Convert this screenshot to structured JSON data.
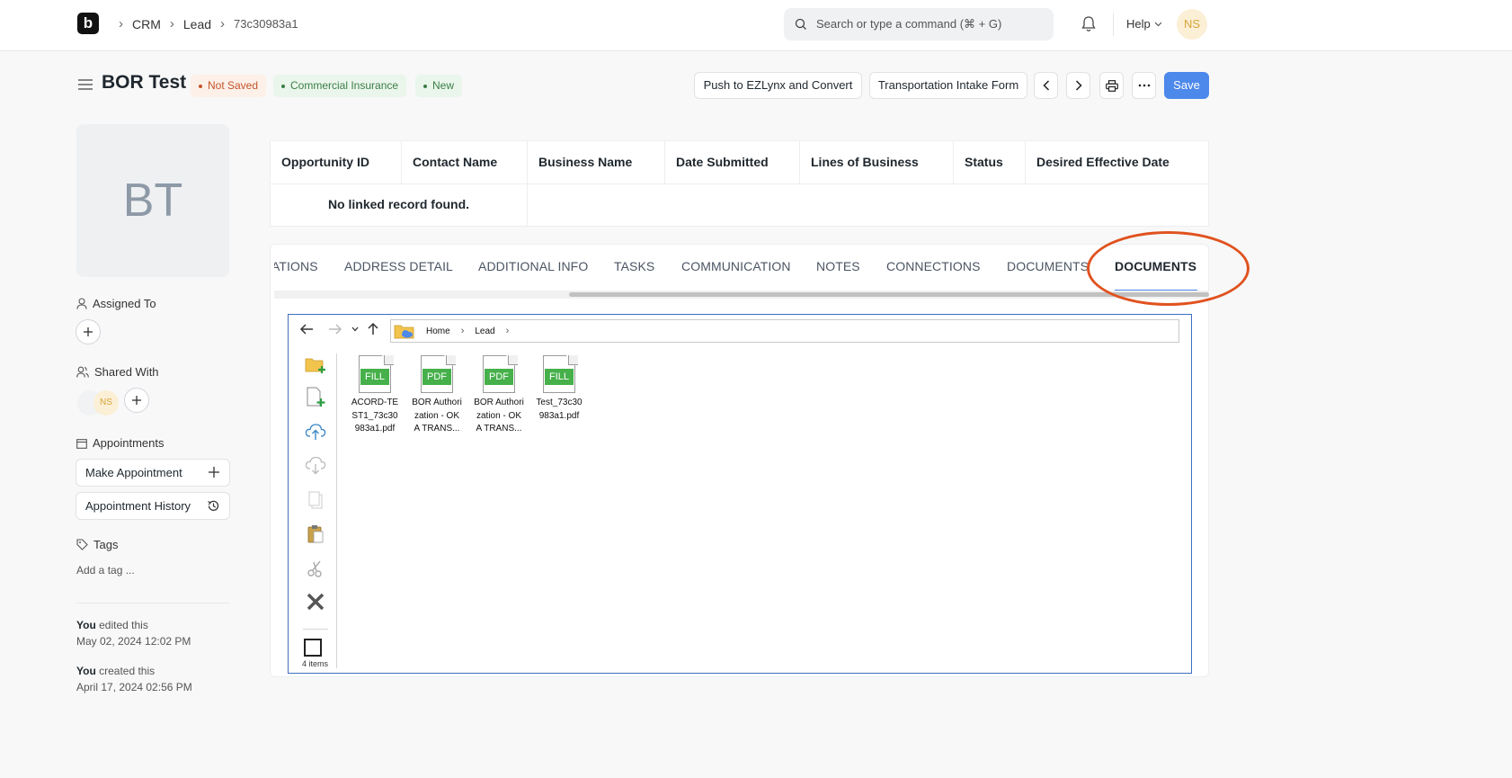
{
  "navbar": {
    "logo": "b",
    "breadcrumbs": [
      "CRM",
      "Lead",
      "73c30983a1"
    ],
    "search_placeholder": "Search or type a command (⌘ + G)",
    "help_label": "Help",
    "user_initials": "NS"
  },
  "header": {
    "title": "BOR Test",
    "badges": {
      "not_saved": "Not Saved",
      "category": "Commercial Insurance",
      "status": "New"
    },
    "buttons": {
      "push": "Push to EZLynx and Convert",
      "transport": "Transportation Intake Form",
      "save": "Save"
    },
    "colors": {
      "primary": "#4d88eb",
      "not_saved": "#c4542a",
      "green": "#3b7d45",
      "highlight": "#e0521f"
    }
  },
  "sidebar": {
    "avatar_initials": "BT",
    "assigned_to_label": "Assigned To",
    "shared_with_label": "Shared With",
    "shared_user_initials": "NS",
    "appointments_label": "Appointments",
    "make_appointment": "Make Appointment",
    "appointment_history": "Appointment History",
    "tags_label": "Tags",
    "add_tag": "Add a tag ...",
    "activity": [
      {
        "who": "You",
        "action": " edited this",
        "when": "May 02, 2024 12:02 PM"
      },
      {
        "who": "You",
        "action": " created this",
        "when": "April 17, 2024 02:56 PM"
      }
    ]
  },
  "linked_table": {
    "columns": [
      "Opportunity ID",
      "Contact Name",
      "Business Name",
      "Date Submitted",
      "Lines of Business",
      "Status",
      "Desired Effective Date"
    ],
    "empty_message": "No linked record found."
  },
  "tabs": [
    "ATIONS",
    "ADDRESS DETAIL",
    "ADDITIONAL INFO",
    "TASKS",
    "COMMUNICATION",
    "NOTES",
    "CONNECTIONS",
    "DOCUMENTS",
    "DOCUMENTS"
  ],
  "active_tab_index": 8,
  "file_manager": {
    "path": [
      "Home",
      "Lead"
    ],
    "item_count": "4 items",
    "files": [
      {
        "badge": "FILL",
        "name": "ACORD-TEST1_73c30983a1.pdf"
      },
      {
        "badge": "PDF",
        "name": "BOR Authorization - OKA TRANS..."
      },
      {
        "badge": "PDF",
        "name": "BOR Authorization - OKA TRANS..."
      },
      {
        "badge": "FILL",
        "name": "Test_73c30983a1.pdf"
      }
    ]
  }
}
